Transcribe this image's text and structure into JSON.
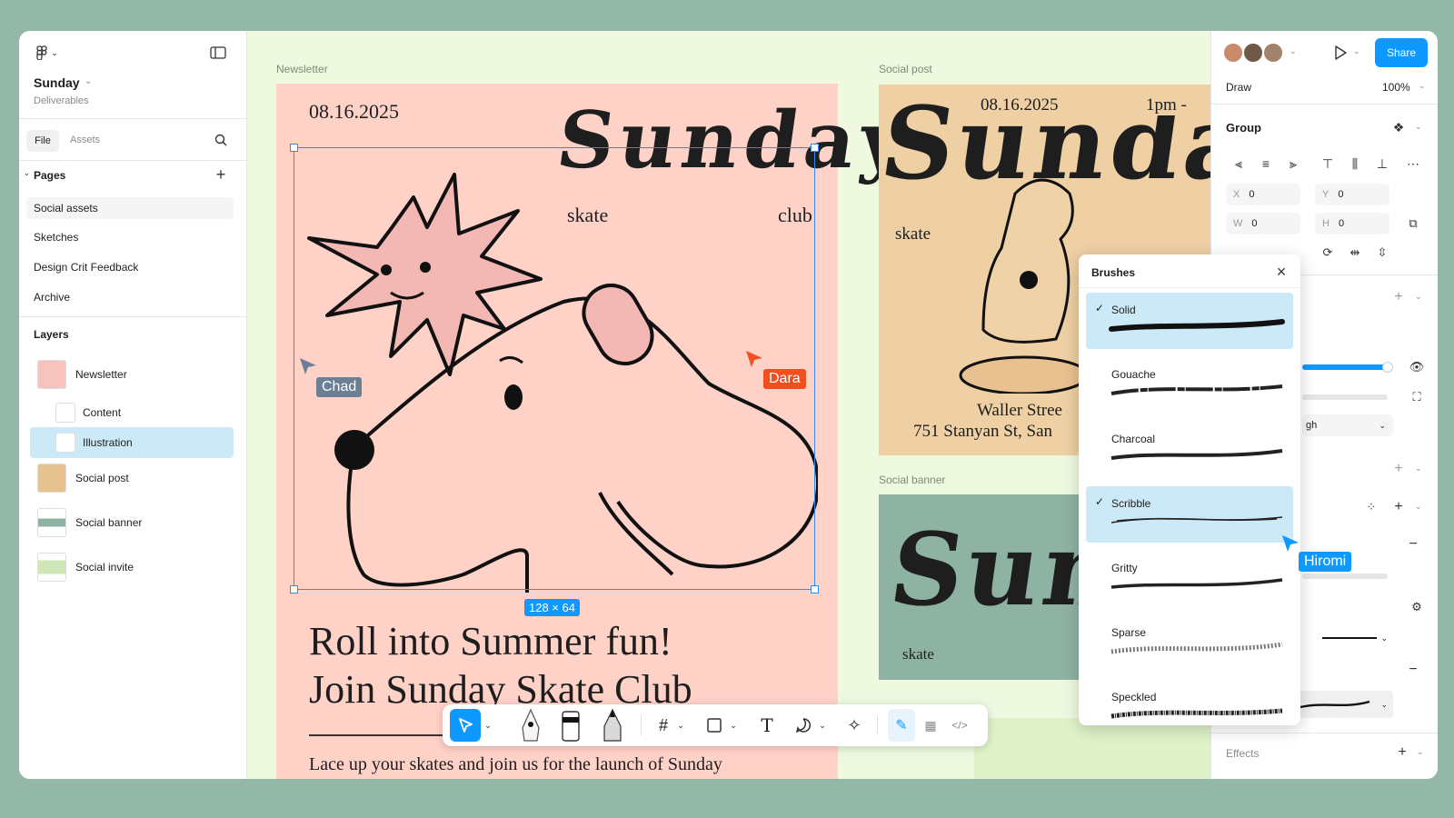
{
  "file": {
    "name": "Sunday",
    "project": "Deliverables"
  },
  "left_tabs": {
    "file": "File",
    "assets": "Assets"
  },
  "pages": {
    "title": "Pages",
    "items": [
      "Social assets",
      "Sketches",
      "Design Crit Feedback",
      "Archive"
    ]
  },
  "layers": {
    "title": "Layers",
    "items": [
      "Newsletter",
      "Content",
      "Illustration",
      "Social post",
      "Social banner",
      "Social invite"
    ]
  },
  "canvas": {
    "frames": {
      "newsletter": "Newsletter",
      "social_post": "Social post",
      "social_banner": "Social banner"
    },
    "newsletter": {
      "date": "08.16.2025",
      "title_art": "Sunday",
      "skate": "skate",
      "club": "club",
      "headline1": "Roll into Summer fun!",
      "headline2": "Join Sunday Skate Club",
      "body": "Lace up your skates and join us for the launch of Sunday"
    },
    "social_post": {
      "date": "08.16.2025",
      "time": "1pm -",
      "skate": "skate",
      "address1": "Waller Stree",
      "address2": "751 Stanyan St, San"
    },
    "social_banner": {
      "skate": "skate"
    },
    "selection_size": "128 × 64",
    "cursors": [
      {
        "name": "Chad",
        "color": "#6b7f95"
      },
      {
        "name": "Dara",
        "color": "#f24e1e"
      },
      {
        "name": "Hiromi",
        "color": "#0d99ff"
      }
    ]
  },
  "right_panel": {
    "share": "Share",
    "mode": "Draw",
    "zoom": "100%",
    "group": "Group",
    "x": "0",
    "y": "0",
    "w": "0",
    "h": "0",
    "effects": "Effects",
    "blend_fragment": "gh"
  },
  "brushes": {
    "title": "Brushes",
    "items": [
      {
        "name": "Solid",
        "selected": true
      },
      {
        "name": "Gouache",
        "selected": false
      },
      {
        "name": "Charcoal",
        "selected": false
      },
      {
        "name": "Scribble",
        "selected": true
      },
      {
        "name": "Gritty",
        "selected": false
      },
      {
        "name": "Sparse",
        "selected": false
      },
      {
        "name": "Speckled",
        "selected": false
      }
    ]
  },
  "colors": {
    "accent": "#0d99ff",
    "selection": "#cce9f7",
    "newsletter_bg": "#ffd2c8",
    "post_bg": "#efcfa4",
    "banner_bg": "#8fb3a3",
    "canvas_bg": "#eef9e0"
  }
}
